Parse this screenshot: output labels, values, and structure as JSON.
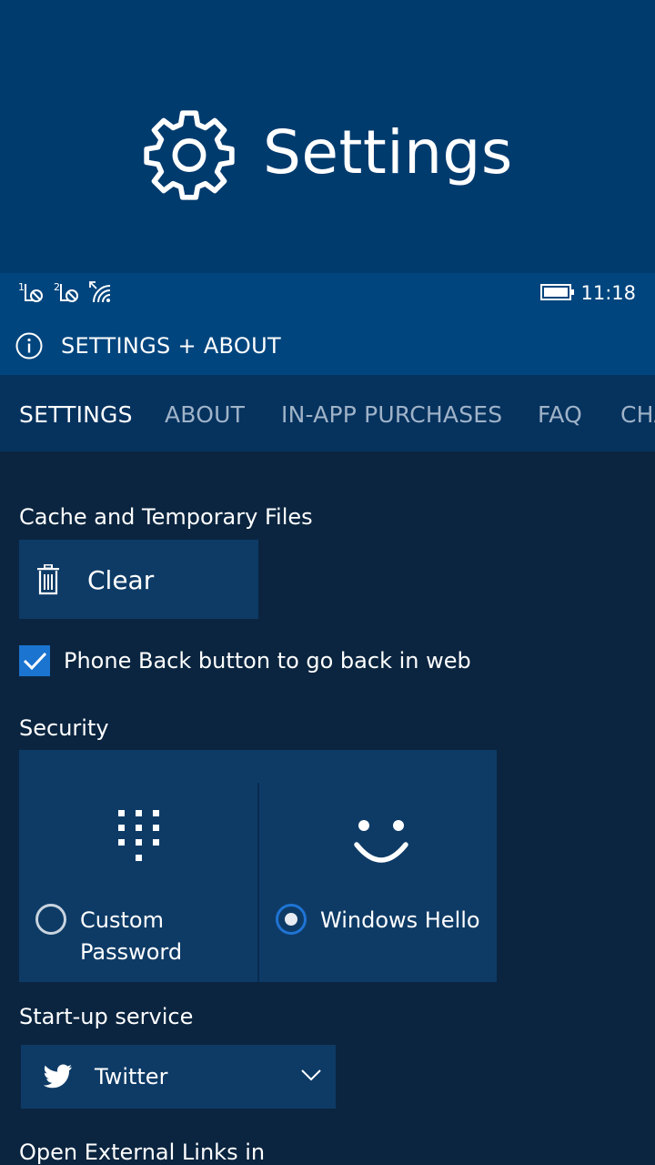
{
  "splash": {
    "title": "Settings",
    "icon": "gear-icon"
  },
  "statusbar": {
    "time": "11:18",
    "sim1_label": "1",
    "sim2_label": "2",
    "icons": [
      "sim1-signal-icon",
      "sim2-signal-icon",
      "wifi-icon",
      "battery-icon"
    ]
  },
  "appbar": {
    "title": "SETTINGS + ABOUT",
    "icon": "info-icon"
  },
  "tabs": [
    {
      "label": "SETTINGS",
      "active": true
    },
    {
      "label": "ABOUT",
      "active": false
    },
    {
      "label": "IN-APP PURCHASES",
      "active": false
    },
    {
      "label": "FAQ",
      "active": false
    },
    {
      "label": "CHA",
      "active": false
    }
  ],
  "cache": {
    "heading": "Cache and Temporary Files",
    "button_label": "Clear",
    "button_icon": "trash-icon"
  },
  "back_button": {
    "label": "Phone Back button to go back in web",
    "checked": true
  },
  "security": {
    "heading": "Security",
    "options": [
      {
        "label_line1": "Custom",
        "label_line2": "Password",
        "icon": "keypad-icon",
        "selected": false
      },
      {
        "label_line1": "Windows Hello",
        "icon": "smiley-icon",
        "selected": true
      }
    ]
  },
  "startup": {
    "heading": "Start-up service",
    "selected": "Twitter",
    "icon": "twitter-icon"
  },
  "external_links": {
    "heading": "Open External Links in"
  },
  "colors": {
    "splash_bg": "#003b6e",
    "appbar_bg": "#00457e",
    "pivot_bg": "#06325e",
    "content_bg": "#0b2540",
    "control_bg": "#0e3b66",
    "accent": "#1a74d0"
  }
}
